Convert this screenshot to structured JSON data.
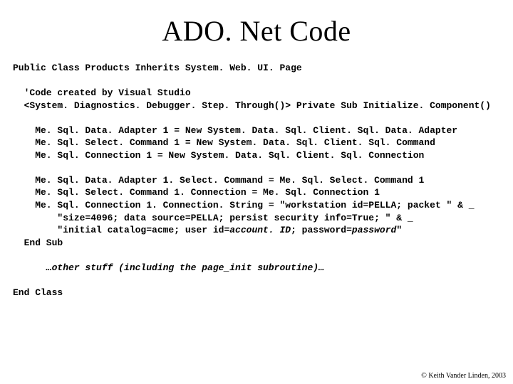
{
  "title": "ADO. Net Code",
  "code": {
    "l01": "Public Class Products Inherits System. Web. UI. Page",
    "l02": "",
    "l03": "  'Code created by Visual Studio",
    "l04": "  <System. Diagnostics. Debugger. Step. Through()> Private Sub Initialize. Component()",
    "l05": "",
    "l06": "    Me. Sql. Data. Adapter 1 = New System. Data. Sql. Client. Sql. Data. Adapter",
    "l07": "    Me. Sql. Select. Command 1 = New System. Data. Sql. Client. Sql. Command",
    "l08": "    Me. Sql. Connection 1 = New System. Data. Sql. Client. Sql. Connection",
    "l09": "",
    "l10": "    Me. Sql. Data. Adapter 1. Select. Command = Me. Sql. Select. Command 1",
    "l11": "    Me. Sql. Select. Command 1. Connection = Me. Sql. Connection 1",
    "l12": "    Me. Sql. Connection 1. Connection. String = \"workstation id=PELLA; packet \" & _",
    "l13": "        \"size=4096; data source=PELLA; persist security info=True; \" & _",
    "l14_prefix": "        \"initial catalog=acme; user id=",
    "l14_em1": "account. ID",
    "l14_mid": "; password=",
    "l14_em2": "password",
    "l14_suffix": "\"",
    "l15": "  End Sub",
    "l16": "",
    "l17": "      …other stuff (including the page_init subroutine)…",
    "l18": "",
    "l19": "End Class"
  },
  "footer": "© Keith Vander Linden, 2003"
}
